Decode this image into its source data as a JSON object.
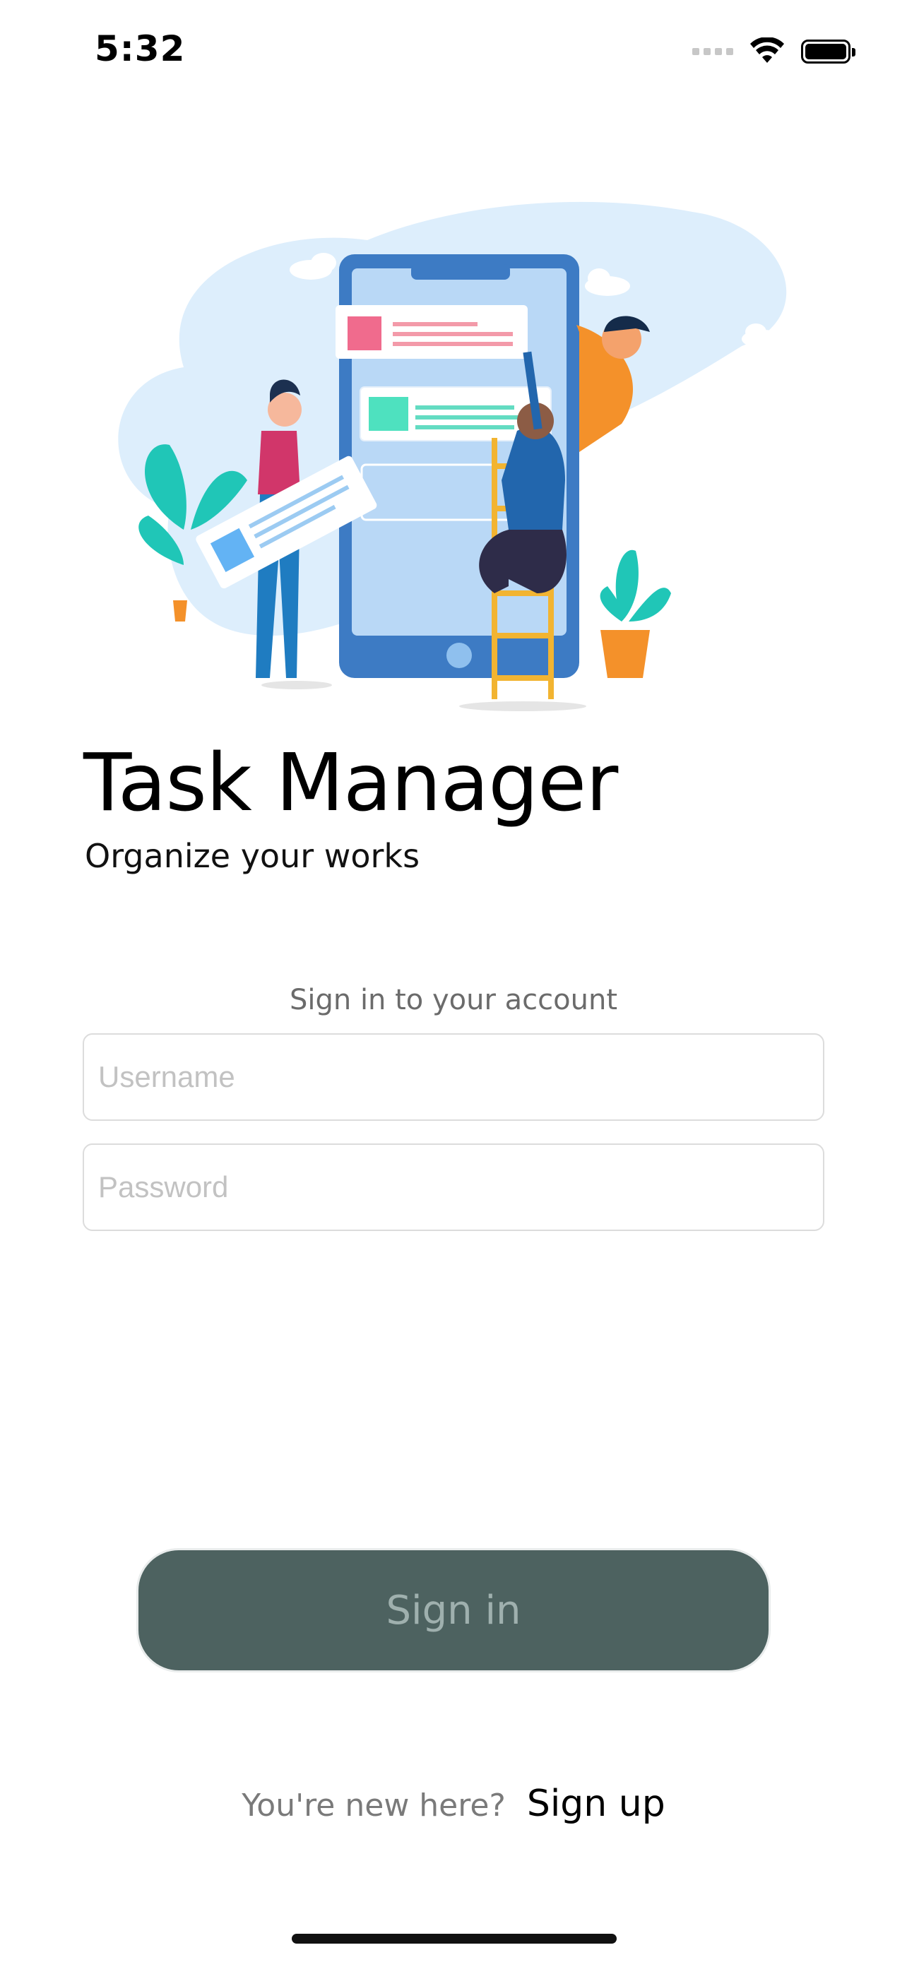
{
  "status_bar": {
    "time": "5:32"
  },
  "app": {
    "title": "Task Manager",
    "subtitle": "Organize your works"
  },
  "form": {
    "caption": "Sign in to your account",
    "username_placeholder": "Username",
    "password_placeholder": "Password",
    "submit_label": "Sign in"
  },
  "footer": {
    "question": "You're new here?",
    "link": "Sign up"
  },
  "colors": {
    "button_bg": "#4d6260",
    "button_text": "#9fb0ae",
    "illustration_blob": "#ddeefc",
    "phone_frame": "#3d7bc4"
  },
  "icons": [
    "wifi-icon",
    "battery-icon",
    "cellular-signal-icon"
  ]
}
